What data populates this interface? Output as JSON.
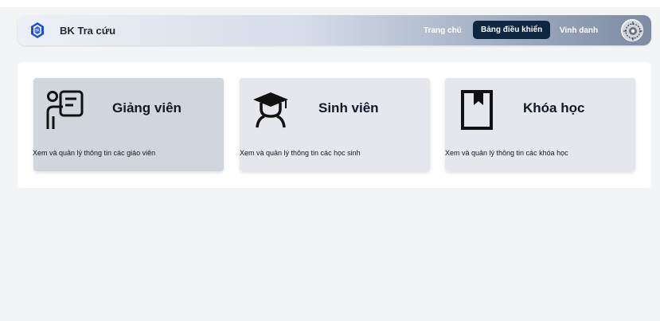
{
  "navbar": {
    "brand_name": "BK Tra cứu",
    "links": {
      "home": "Trang chủ",
      "dashboard": "Bảng điều khiển",
      "honor": "Vinh danh"
    },
    "active_color": "#0f2640"
  },
  "cards": [
    {
      "icon": "teacher-icon",
      "title": "Giảng viên",
      "description": "Xem và quản lý thông tin các giáo viên"
    },
    {
      "icon": "student-graduate-icon",
      "title": "Sinh viên",
      "description": "Xem và quản lý thông tin các học sinh"
    },
    {
      "icon": "book-bookmark-icon",
      "title": "Khóa học",
      "description": "Xem và quản lý thông tin các khóa học"
    }
  ]
}
